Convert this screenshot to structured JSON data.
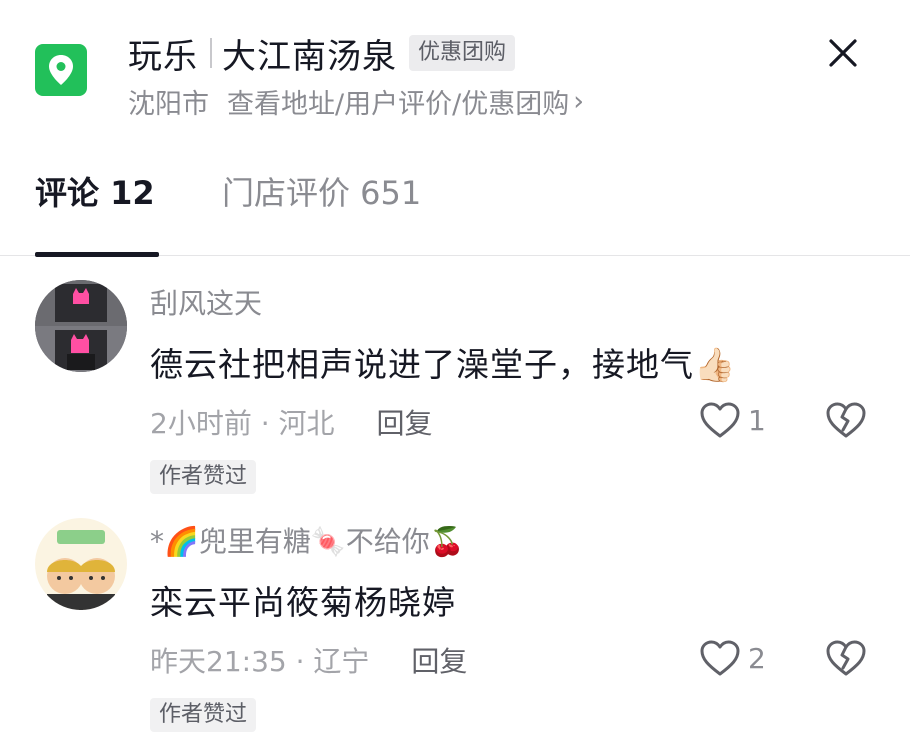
{
  "header": {
    "category": "玩乐",
    "place": "大江南汤泉",
    "tag": "优惠团购",
    "city": "沈阳市",
    "links": "查看地址/用户评价/优惠团购",
    "chevron": "›"
  },
  "tabs": [
    {
      "label": "评论 12"
    },
    {
      "label": "门店评价 651"
    }
  ],
  "comments": [
    {
      "user": "刮风这天",
      "text": "德云社把相声说进了澡堂子，接地气👍🏻",
      "time_location": "2小时前 · 河北",
      "reply": "回复",
      "likes": "1",
      "badge": "作者赞过"
    },
    {
      "user": "*🌈兜里有糖🍬不给你🍒",
      "text": "栾云平尚筱菊杨晓婷",
      "time_location": "昨天21:35 · 辽宁",
      "reply": "回复",
      "likes": "2",
      "badge": "作者赞过"
    }
  ],
  "colors": {
    "accent_green": "#22c05a",
    "text_primary": "#161823",
    "text_secondary": "#8a8b91"
  }
}
